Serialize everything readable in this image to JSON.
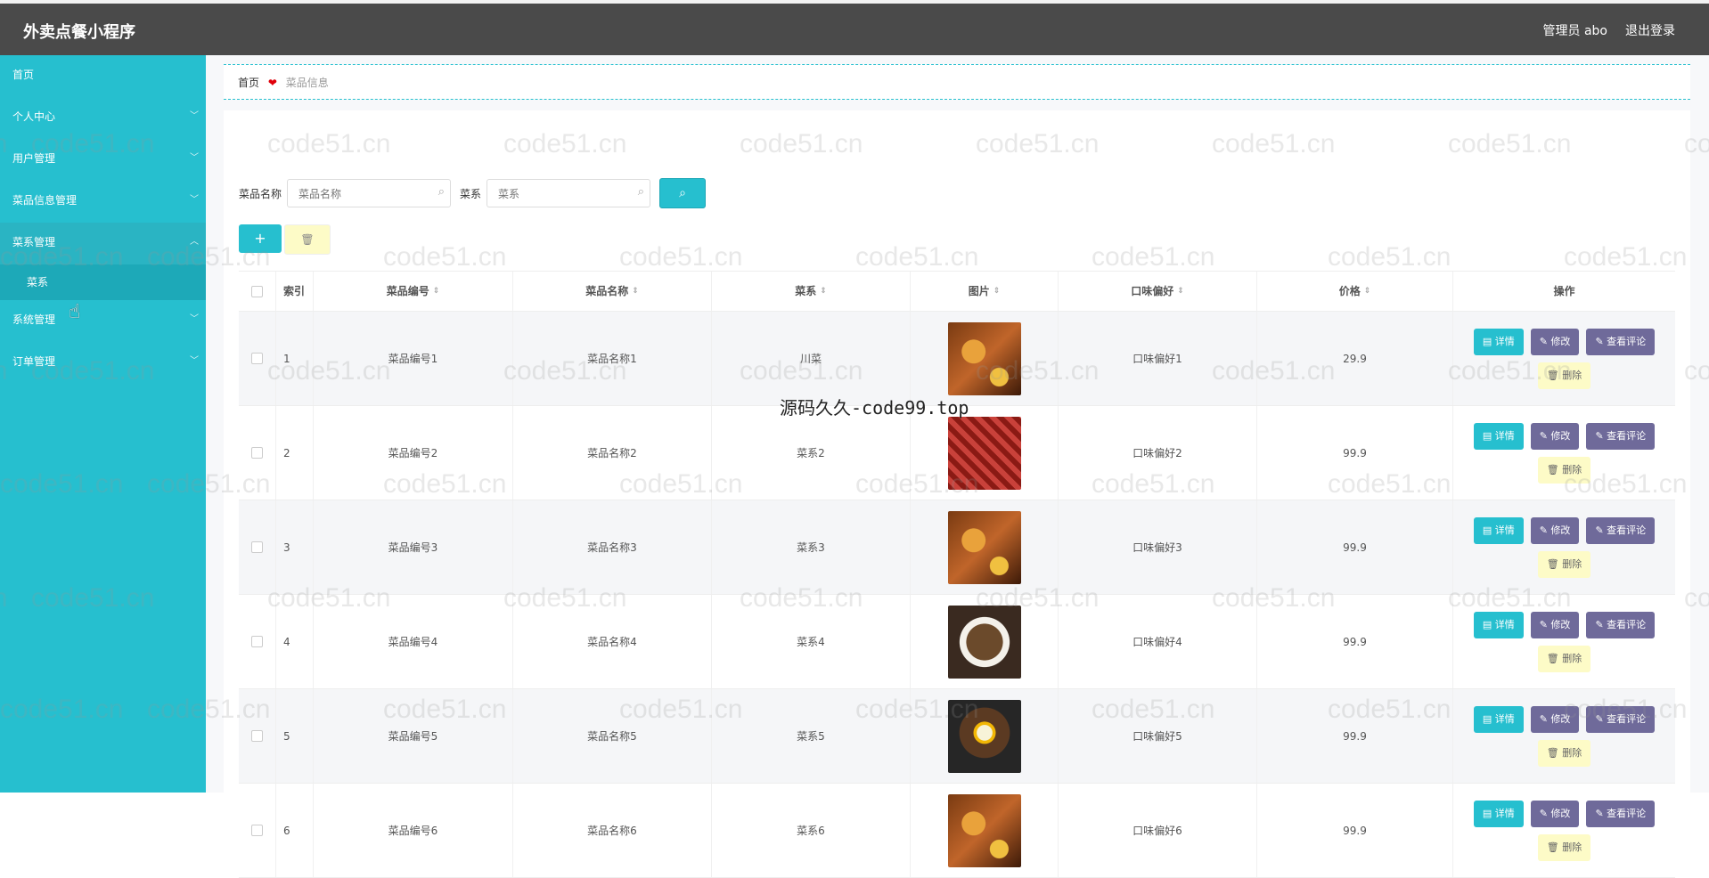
{
  "header": {
    "title": "外卖点餐小程序",
    "admin_label": "管理员 abo",
    "logout_label": "退出登录"
  },
  "sidebar": {
    "items": [
      {
        "label": "首页",
        "has_chevron": false
      },
      {
        "label": "个人中心",
        "has_chevron": true
      },
      {
        "label": "用户管理",
        "has_chevron": true
      },
      {
        "label": "菜品信息管理",
        "has_chevron": true
      },
      {
        "label": "菜系管理",
        "has_chevron": true,
        "expanded": true
      },
      {
        "label": "系统管理",
        "has_chevron": true
      },
      {
        "label": "订单管理",
        "has_chevron": true
      }
    ],
    "sub_items": [
      {
        "label": "菜系"
      }
    ]
  },
  "breadcrumb": {
    "home": "首页",
    "separator": "❤",
    "current": "菜品信息"
  },
  "search": {
    "name_label": "菜品名称",
    "name_placeholder": "菜品名称",
    "cat_label": "菜系",
    "cat_placeholder": "菜系",
    "search_icon": "search-icon"
  },
  "toolbar": {
    "add_label": "+",
    "delete_icon": "trash-icon"
  },
  "table": {
    "headers": {
      "index": "索引",
      "no": "菜品编号",
      "name": "菜品名称",
      "cat": "菜系",
      "img": "图片",
      "taste": "口味偏好",
      "price": "价格",
      "ops": "操作"
    },
    "rows": [
      {
        "index": "1",
        "no": "菜品编号1",
        "name": "菜品名称1",
        "cat": "川菜",
        "taste": "口味偏好1",
        "price": "29.9"
      },
      {
        "index": "2",
        "no": "菜品编号2",
        "name": "菜品名称2",
        "cat": "菜系2",
        "taste": "口味偏好2",
        "price": "99.9"
      },
      {
        "index": "3",
        "no": "菜品编号3",
        "name": "菜品名称3",
        "cat": "菜系3",
        "taste": "口味偏好3",
        "price": "99.9"
      },
      {
        "index": "4",
        "no": "菜品编号4",
        "name": "菜品名称4",
        "cat": "菜系4",
        "taste": "口味偏好4",
        "price": "99.9"
      },
      {
        "index": "5",
        "no": "菜品编号5",
        "name": "菜品名称5",
        "cat": "菜系5",
        "taste": "口味偏好5",
        "price": "99.9"
      },
      {
        "index": "6",
        "no": "菜品编号6",
        "name": "菜品名称6",
        "cat": "菜系6",
        "taste": "口味偏好6",
        "price": "99.9"
      }
    ],
    "ops": {
      "detail": "详情",
      "edit": "修改",
      "review": "查看评论",
      "delete": "删除"
    }
  },
  "overlay_text": "源码久久-code99.top",
  "watermark": "code51.cn",
  "colors": {
    "primary": "#26bfcf",
    "header": "#4a4a4a",
    "op_purple": "#6f6a9a",
    "op_yellow": "#fdfbc7"
  }
}
